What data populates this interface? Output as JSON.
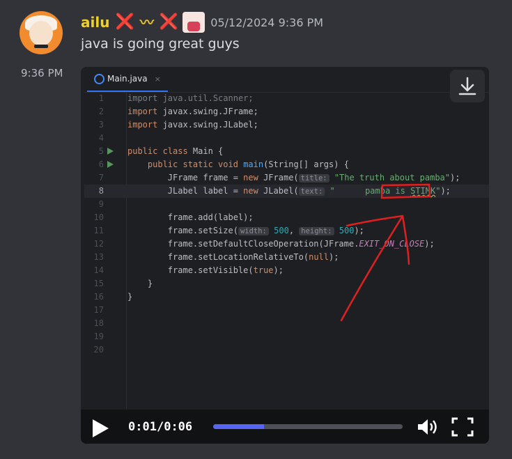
{
  "author": {
    "name": "ailu",
    "emojis": [
      "❌",
      "〰",
      "❌"
    ],
    "timestamp": "05/12/2024 9:36 PM",
    "side_time": "9:36 PM"
  },
  "message": {
    "text": "java is going great guys"
  },
  "colors": {
    "background": "#313338",
    "username": "#f0d12a",
    "progress_fill": "#5865f2",
    "annotation": "#e02020"
  },
  "video": {
    "current_time": "0:01",
    "separator": "/",
    "duration": "0:06",
    "progress_fraction": 0.27,
    "download_icon": "download-icon",
    "play_icon": "play-icon",
    "volume_icon": "volume-icon",
    "fullscreen_icon": "fullscreen-icon"
  },
  "editor": {
    "tab": {
      "label": "Main.java",
      "close": "×"
    },
    "current_line": 8,
    "run_lines": [
      5,
      6
    ],
    "lines": [
      [
        {
          "t": "import java.util.Scanner;",
          "c": "dim"
        }
      ],
      [
        {
          "t": "import ",
          "c": "kw"
        },
        {
          "t": "javax.swing.JFrame;"
        }
      ],
      [
        {
          "t": "import ",
          "c": "kw"
        },
        {
          "t": "javax.swing.JLabel;"
        }
      ],
      [],
      [
        {
          "t": "public class ",
          "c": "kw"
        },
        {
          "t": "Main {"
        }
      ],
      [
        {
          "t": "    "
        },
        {
          "t": "public static void ",
          "c": "kw"
        },
        {
          "t": "main",
          "c": "fn"
        },
        {
          "t": "(String[] args) {"
        }
      ],
      [
        {
          "t": "        JFrame frame = "
        },
        {
          "t": "new ",
          "c": "kw"
        },
        {
          "t": "JFrame("
        },
        {
          "t": "title:",
          "c": "hint"
        },
        {
          "t": " "
        },
        {
          "t": "\"The truth about pamba\"",
          "c": "str"
        },
        {
          "t": ");"
        }
      ],
      [
        {
          "t": "        JLabel label = "
        },
        {
          "t": "new ",
          "c": "kw"
        },
        {
          "t": "JLabel("
        },
        {
          "t": "text:",
          "c": "hint"
        },
        {
          "t": " "
        },
        {
          "t": "\"      pamba is ",
          "c": "str"
        },
        {
          "t": "STIMK",
          "c": "str scribble"
        },
        {
          "t": "\"",
          "c": "str"
        },
        {
          "t": ");"
        }
      ],
      [],
      [
        {
          "t": "        frame.add(label);"
        }
      ],
      [
        {
          "t": "        frame.setSize("
        },
        {
          "t": "width:",
          "c": "hint"
        },
        {
          "t": " "
        },
        {
          "t": "500",
          "c": "num"
        },
        {
          "t": ", "
        },
        {
          "t": "height:",
          "c": "hint"
        },
        {
          "t": " "
        },
        {
          "t": "500",
          "c": "num"
        },
        {
          "t": ");"
        }
      ],
      [
        {
          "t": "        frame.setDefaultCloseOperation(JFrame."
        },
        {
          "t": "EXIT_ON_CLOSE",
          "c": "const"
        },
        {
          "t": ");"
        }
      ],
      [
        {
          "t": "        frame.setLocationRelativeTo("
        },
        {
          "t": "null",
          "c": "kw"
        },
        {
          "t": ");"
        }
      ],
      [
        {
          "t": "        frame.setVisible("
        },
        {
          "t": "true",
          "c": "kw"
        },
        {
          "t": ");"
        }
      ],
      [
        {
          "t": "    }"
        }
      ],
      [
        {
          "t": "}"
        }
      ],
      [],
      [],
      [],
      []
    ]
  }
}
